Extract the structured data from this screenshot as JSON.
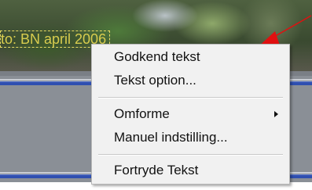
{
  "caption": {
    "text": "to: BN april 2006"
  },
  "context_menu": {
    "items": [
      {
        "label": "Godkend tekst"
      },
      {
        "label": "Tekst option..."
      },
      {
        "label": "Omforme",
        "has_submenu": true
      },
      {
        "label": "Manuel indstilling..."
      },
      {
        "label": "Fortryde Tekst"
      }
    ]
  },
  "colors": {
    "pointer_arrow": "#e01010",
    "caption_text": "#d8cc4e",
    "blue_band": "#2f4fb0"
  },
  "icons": {
    "pointer_arrow": "red-arrow-icon",
    "submenu_indicator": "chevron-right-icon"
  }
}
